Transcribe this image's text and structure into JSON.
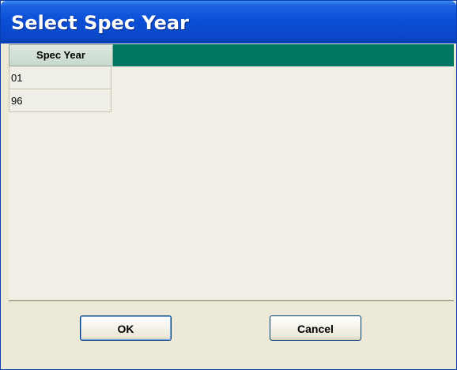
{
  "window": {
    "title": "Select Spec Year"
  },
  "table": {
    "column_header": "Spec Year",
    "rows": [
      "01",
      "96"
    ]
  },
  "buttons": {
    "ok_label": "OK",
    "cancel_label": "Cancel"
  }
}
